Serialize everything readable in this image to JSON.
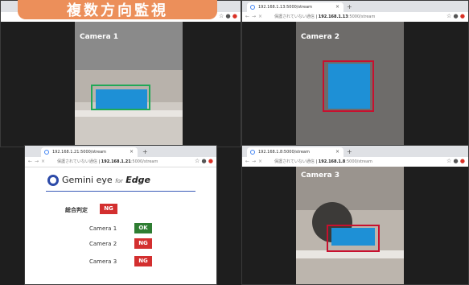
{
  "banner": {
    "title": "複数方向監視"
  },
  "windows": {
    "tr": {
      "tab_title": "192.168.1.13:5000/stream",
      "url_warning": "保護されていない通信",
      "url": "192.168.1.13",
      "url_rest": ":5000/stream",
      "camera_title": "Camera 2"
    },
    "tl": {
      "camera_title": "Camera 1"
    },
    "bl": {
      "tab_title": "192.168.1.21:5000/stream",
      "url_warning": "保護されていない通信",
      "url": "192.168.1.21",
      "url_rest": ":5000/stream"
    },
    "br": {
      "tab_title": "192.168.1.8:5000/stream",
      "url_warning": "保護されていない通信",
      "url": "192.168.1.8",
      "url_rest": ":5000/stream",
      "camera_title": "Camera 3"
    }
  },
  "gemini": {
    "brand": "Gemini eye",
    "for": "for",
    "edge": "Edge",
    "overall_label": "総合判定",
    "overall_status": "NG",
    "cameras": [
      {
        "label": "Camera 1",
        "status": "OK"
      },
      {
        "label": "Camera 2",
        "status": "NG"
      },
      {
        "label": "Camera 3",
        "status": "NG"
      }
    ]
  },
  "colors": {
    "ok": "#2e7d32",
    "ng": "#d32f2f",
    "banner": "#ec8f5a",
    "detect_ok": "#21a857",
    "detect_ng": "#c8102e"
  },
  "icons": {
    "star": "star-icon",
    "account": "account-icon",
    "close": "close-icon",
    "reload": "reload-icon"
  }
}
